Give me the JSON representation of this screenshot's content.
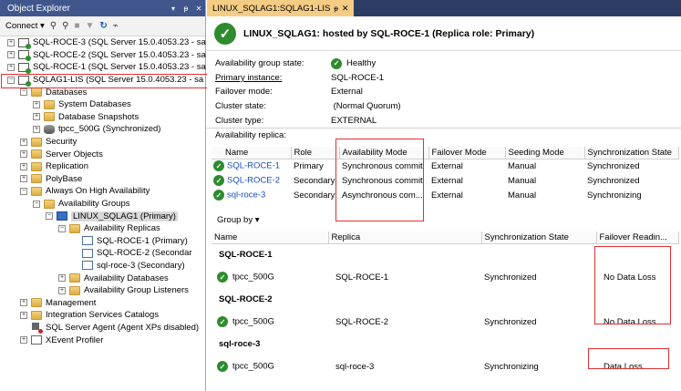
{
  "object_explorer": {
    "title": "Object Explorer",
    "title_buttons": [
      "▾",
      "ᵽ",
      "✕"
    ],
    "toolbar": {
      "connect_label": "Connect ▾"
    },
    "nodes": [
      {
        "label": "SQL-ROCE-3 (SQL Server 15.0.4053.23 - sa",
        "icon": "server-icon",
        "expander": "+",
        "level": 0
      },
      {
        "label": "SQL-ROCE-2 (SQL Server 15.0.4053.23 - sa",
        "icon": "server-icon",
        "expander": "+",
        "level": 0
      },
      {
        "label": "SQL-ROCE-1 (SQL Server 15.0.4053.23 - sa",
        "icon": "server-icon",
        "expander": "+",
        "level": 0
      },
      {
        "label": "SQLAG1-LIS (SQL Server 15.0.4053.23 - sa",
        "icon": "server-icon",
        "expander": "−",
        "level": 0
      },
      {
        "label": "Databases",
        "icon": "folder-icon",
        "expander": "−",
        "level": 1
      },
      {
        "label": "System Databases",
        "icon": "folder-icon",
        "expander": "+",
        "level": 2
      },
      {
        "label": "Database Snapshots",
        "icon": "folder-icon",
        "expander": "+",
        "level": 2
      },
      {
        "label": "tpcc_500G (Synchronized)",
        "icon": "database-icon",
        "expander": "+",
        "level": 2
      },
      {
        "label": "Security",
        "icon": "folder-icon",
        "expander": "+",
        "level": 1
      },
      {
        "label": "Server Objects",
        "icon": "folder-icon",
        "expander": "+",
        "level": 1
      },
      {
        "label": "Replication",
        "icon": "folder-icon",
        "expander": "+",
        "level": 1
      },
      {
        "label": "PolyBase",
        "icon": "folder-icon",
        "expander": "+",
        "level": 1
      },
      {
        "label": "Always On High Availability",
        "icon": "folder-icon",
        "expander": "−",
        "level": 1
      },
      {
        "label": "Availability Groups",
        "icon": "folder-icon",
        "expander": "−",
        "level": 2
      },
      {
        "label": "LINUX_SQLAG1 (Primary)",
        "icon": "availability-group-icon",
        "expander": "−",
        "level": 3,
        "selected": true
      },
      {
        "label": "Availability Replicas",
        "icon": "folder-icon",
        "expander": "−",
        "level": 4
      },
      {
        "label": "SQL-ROCE-1 (Primary)",
        "icon": "replica-icon",
        "expander": "",
        "level": 5
      },
      {
        "label": "SQL-ROCE-2 (Secondar",
        "icon": "replica-icon",
        "expander": "",
        "level": 5
      },
      {
        "label": "sql-roce-3 (Secondary)",
        "icon": "replica-icon",
        "expander": "",
        "level": 5
      },
      {
        "label": "Availability Databases",
        "icon": "folder-icon",
        "expander": "+",
        "level": 4
      },
      {
        "label": "Availability Group Listeners",
        "icon": "folder-icon",
        "expander": "+",
        "level": 4
      },
      {
        "label": "Management",
        "icon": "folder-icon",
        "expander": "+",
        "level": 1
      },
      {
        "label": "Integration Services Catalogs",
        "icon": "folder-icon",
        "expander": "+",
        "level": 1
      },
      {
        "label": "SQL Server Agent (Agent XPs disabled)",
        "icon": "sql-agent-icon",
        "expander": "",
        "level": 1
      },
      {
        "label": "XEvent Profiler",
        "icon": "xevent-profiler-icon",
        "expander": "+",
        "level": 1
      }
    ]
  },
  "document_tab": {
    "label": "LINUX_SQLAG1:SQLAG1-LIS",
    "pin": "ᵽ",
    "close": "✕"
  },
  "dashboard": {
    "title": "LINUX_SQLAG1: hosted by SQL-ROCE-1 (Replica role: Primary)",
    "properties": [
      {
        "label": "Availability group state:",
        "value": "Healthy",
        "ok_icon": true
      },
      {
        "label": "Primary instance:",
        "value": "SQL-ROCE-1"
      },
      {
        "label": "Failover mode:",
        "value": "External"
      },
      {
        "label": "Cluster state:",
        "value": " (Normal Quorum)"
      },
      {
        "label": "Cluster type:",
        "value": "EXTERNAL"
      }
    ],
    "availability_replica_label": "Availability replica:",
    "replica_columns": [
      "Name",
      "Role",
      "Availability Mode",
      "Failover Mode",
      "Seeding Mode",
      "Synchronization State"
    ],
    "replicas": [
      {
        "name": "SQL-ROCE-1",
        "role": "Primary",
        "mode": "Synchronous commit",
        "failover": "External",
        "seeding": "Manual",
        "sync": "Synchronized"
      },
      {
        "name": "SQL-ROCE-2",
        "role": "Secondary",
        "mode": "Synchronous commit",
        "failover": "External",
        "seeding": "Manual",
        "sync": "Synchronized"
      },
      {
        "name": "sql-roce-3",
        "role": "Secondary",
        "mode": "Asynchronous com...",
        "failover": "External",
        "seeding": "Manual",
        "sync": "Synchronizing"
      }
    ],
    "group_by_label": "Group by ▾",
    "db_columns": [
      "Name",
      "Replica",
      "Synchronization State",
      "Failover Readin..."
    ],
    "groups": [
      {
        "name": "SQL-ROCE-1",
        "rows": [
          {
            "db": "tpcc_500G",
            "replica": "SQL-ROCE-1",
            "sync": "Synchronized",
            "failover": "No Data Loss"
          }
        ]
      },
      {
        "name": "SQL-ROCE-2",
        "rows": [
          {
            "db": "tpcc_500G",
            "replica": "SQL-ROCE-2",
            "sync": "Synchronized",
            "failover": "No Data Loss"
          }
        ]
      },
      {
        "name": "sql-roce-3",
        "rows": [
          {
            "db": "tpcc_500G",
            "replica": "sql-roce-3",
            "sync": "Synchronizing",
            "failover": "Data Loss"
          }
        ]
      }
    ]
  }
}
